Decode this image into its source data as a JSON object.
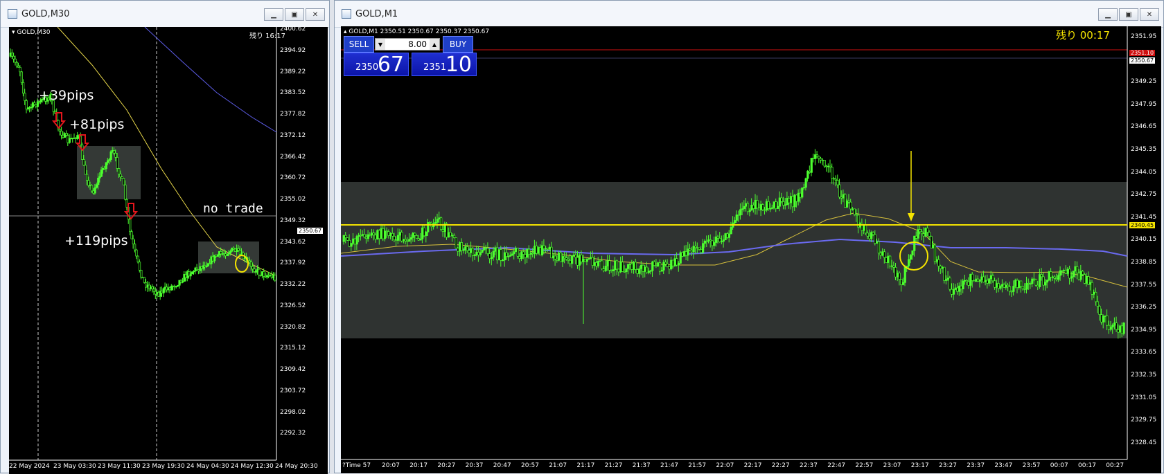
{
  "left_window": {
    "title": "GOLD,M30",
    "controls": {
      "minimize": "minimize-icon",
      "maximize": "maximize-icon",
      "close": "close-icon"
    },
    "symbol_label": "GOLD,M30",
    "remaining": "残り 16:17",
    "price_axis": [
      "2400.62",
      "2394.92",
      "2389.22",
      "2383.52",
      "2377.82",
      "2372.12",
      "2366.42",
      "2360.72",
      "2355.02",
      "2349.32",
      "2343.62",
      "2337.92",
      "2332.22",
      "2326.52",
      "2320.82",
      "2315.12",
      "2309.42",
      "2303.72",
      "2298.02",
      "2292.32"
    ],
    "current_price": "2350.67",
    "time_axis": [
      "22 May 2024",
      "23 May 03:30",
      "23 May 11:30",
      "23 May 19:30",
      "24 May 04:30",
      "24 May 12:30",
      "24 May 20:30"
    ],
    "annotations": [
      "+39pips",
      "+81pips",
      "+119pips",
      "no trade"
    ],
    "arrow_color": "#e3161c",
    "candle_color": "#4cff2e",
    "ma_fast_color": "#e8d84a",
    "ma_slow_color": "#5c5ce6"
  },
  "right_window": {
    "title": "GOLD,M1",
    "controls": {
      "minimize": "minimize-icon",
      "maximize": "maximize-icon",
      "close": "close-icon"
    },
    "symbol_label": "GOLD,M1  2350.51 2350.67 2350.37 2350.67",
    "remaining": "残り 00:17",
    "trade_panel": {
      "sell_label": "SELL",
      "buy_label": "BUY",
      "lot_value": "8.00",
      "bid_prefix": "2350",
      "bid_big": "67",
      "ask_prefix": "2351",
      "ask_big": "10"
    },
    "price_axis": [
      "2351.95",
      "2350.67",
      "2349.25",
      "2347.95",
      "2346.65",
      "2345.35",
      "2344.05",
      "2342.75",
      "2341.45",
      "2340.15",
      "2338.85",
      "2337.55",
      "2336.25",
      "2334.95",
      "2333.65",
      "2332.35",
      "2331.05",
      "2329.75",
      "2328.45"
    ],
    "ask_tag": "2351.10",
    "bid_tag": "2350.67",
    "level_tag": "2340.45",
    "time_axis": [
      "20:07",
      "20:17",
      "20:27",
      "20:37",
      "20:47",
      "20:57",
      "21:07",
      "21:17",
      "21:27",
      "21:37",
      "21:47",
      "21:57",
      "22:07",
      "22:17",
      "22:27",
      "22:37",
      "22:47",
      "22:57",
      "23:07",
      "23:17",
      "23:27",
      "23:37",
      "23:47",
      "23:57",
      "00:07",
      "00:17",
      "00:27"
    ],
    "time_first": "?Time 57",
    "accent_yellow": "#f5e400",
    "ask_line_color": "#d01010",
    "candle_color": "#4cff2e",
    "ma_fast_color": "#d8c23c",
    "ma_slow_color": "#6a6af0"
  }
}
